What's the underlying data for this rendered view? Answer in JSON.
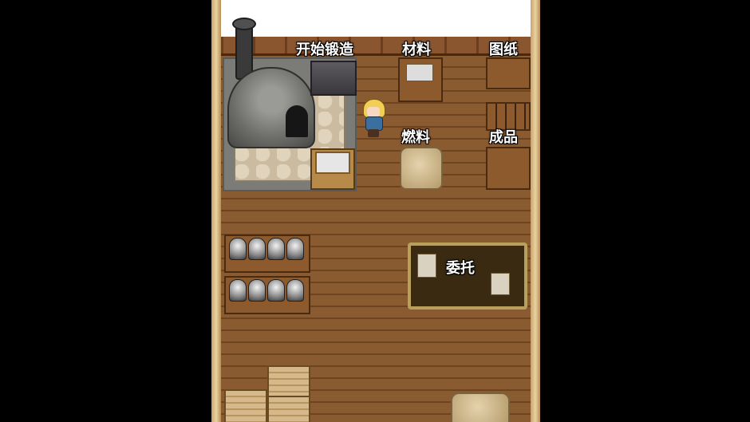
{
  "game": {
    "labels": {
      "start_forge": "开始锻造",
      "materials": "材料",
      "blueprints": "图纸",
      "fuel": "燃料",
      "products": "成品",
      "commission": "委托"
    }
  }
}
